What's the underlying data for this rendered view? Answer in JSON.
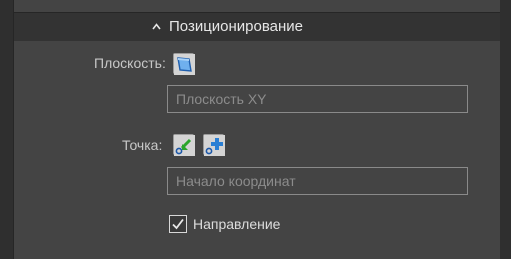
{
  "section": {
    "title": "Позиционирование",
    "collapse_icon": "chevron-up-icon"
  },
  "plane": {
    "label": "Плоскость:",
    "icon": "plane-select-icon",
    "field_placeholder": "Плоскость XY"
  },
  "point": {
    "label": "Точка:",
    "icon_select": "point-select-icon",
    "icon_create": "point-create-icon",
    "field_placeholder": "Начало координат"
  },
  "direction": {
    "label": "Направление",
    "checked": true
  },
  "colors": {
    "background": "#444444",
    "header": "#333333",
    "icon_blue": "#2a7fd4",
    "icon_green": "#3bb33b"
  }
}
